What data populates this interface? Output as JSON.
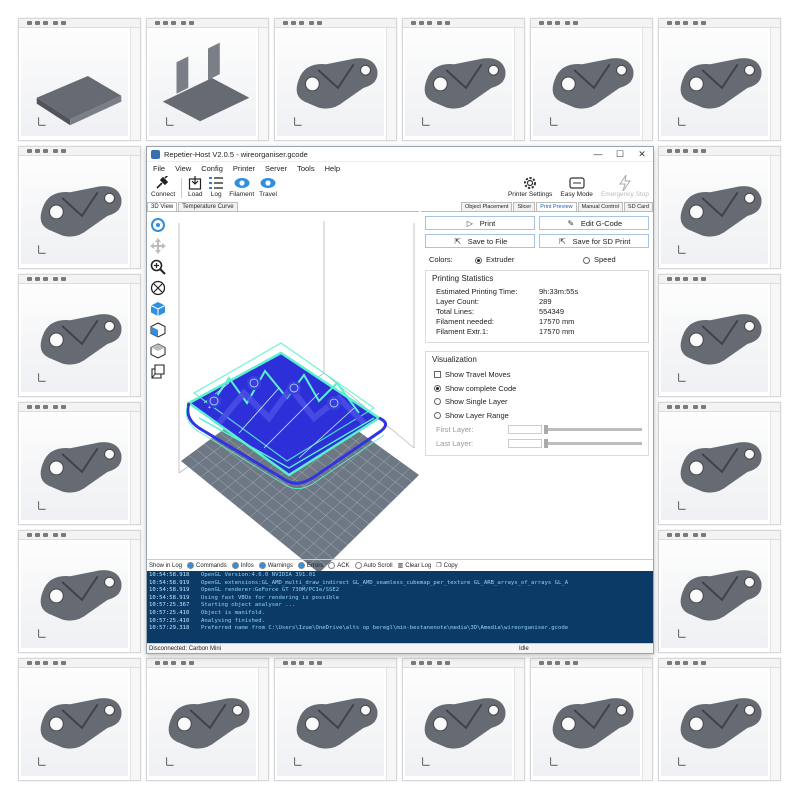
{
  "window": {
    "title": "Repetier-Host V2.0.5 - wireorganiser.gcode",
    "controls": [
      "—",
      "☐",
      "✕"
    ]
  },
  "menu": [
    "File",
    "View",
    "Config",
    "Printer",
    "Server",
    "Tools",
    "Help"
  ],
  "toolbar": {
    "left": [
      {
        "label": "Connect",
        "icon": "plug-icon"
      },
      {
        "label": "Load",
        "icon": "load-icon"
      },
      {
        "label": "Log",
        "icon": "log-icon"
      },
      {
        "label": "Filament",
        "icon": "eye-icon"
      },
      {
        "label": "Travel",
        "icon": "eye-icon"
      }
    ],
    "right": [
      {
        "label": "Printer Settings",
        "icon": "gear-icon"
      },
      {
        "label": "Easy Mode",
        "icon": "easy-mode-icon"
      },
      {
        "label": "Emergency Stop",
        "icon": "lightning-icon"
      }
    ]
  },
  "left_tabs": [
    "3D View",
    "Temperature Curve"
  ],
  "right_tabs": [
    "Object Placement",
    "Slicer",
    "Print Preview",
    "Manual Control",
    "SD Card"
  ],
  "right_active_tab": "Print Preview",
  "actions": {
    "print": "Print",
    "edit_gcode": "Edit G-Code",
    "save_file": "Save to File",
    "save_sd": "Save for SD Print"
  },
  "colors": {
    "label": "Colors:",
    "extruder": "Extruder",
    "speed": "Speed"
  },
  "stats": {
    "title": "Printing Statistics",
    "rows": [
      {
        "k": "Estimated Printing Time:",
        "v": "9h:33m:55s"
      },
      {
        "k": "Layer Count:",
        "v": "289"
      },
      {
        "k": "Total Lines:",
        "v": "554349"
      },
      {
        "k": "Filament needed:",
        "v": "17570 mm"
      },
      {
        "k": "Filament Extr.1:",
        "v": "17570 mm"
      }
    ]
  },
  "visualization": {
    "title": "Visualization",
    "show_travel": "Show Travel Moves",
    "show_complete": "Show complete Code",
    "show_single": "Show Single Layer",
    "show_range": "Show Layer Range",
    "first_layer": "First Layer:",
    "last_layer": "Last Layer:"
  },
  "logbar": {
    "show_in_log": "Show in Log",
    "commands": "Commands",
    "infos": "Infos",
    "warnings": "Warnings",
    "errors": "Errors",
    "ack": "ACK",
    "auto_scroll": "Auto Scroll",
    "clear_log": "Clear Log",
    "copy": "Copy"
  },
  "log": [
    {
      "t": "10:54:58.918",
      "m": "OpenGL Version:4.6.0 NVIDIA 391.01"
    },
    {
      "t": "10:54:58.919",
      "m": "OpenGL extensions:GL_AMD_multi_draw_indirect GL_AMD_seamless_cubemap_per_texture GL_ARB_arrays_of_arrays GL_A"
    },
    {
      "t": "10:54:58.919",
      "m": "OpenGL renderer:GeForce GT 730M/PCIe/SSE2"
    },
    {
      "t": "10:54:58.919",
      "m": "Using fast VBOs for rendering is possible"
    },
    {
      "t": "10:57:25.367",
      "m": "Starting object analyser ..."
    },
    {
      "t": "10:57:25.410",
      "m": "Object is manifold."
    },
    {
      "t": "10:57:25.410",
      "m": "Analysing finished."
    },
    {
      "t": "10:57:29.318",
      "m": "Preferred name from C:\\Users\\Izue\\OneDrive\\alts op beregl\\min-bestanenote\\media\\3D\\Amedia\\wireorganiser.gcode"
    }
  ],
  "status": {
    "connection": "Disconnected: Carbon Mini",
    "state": "Idle"
  },
  "palette": {
    "model": "#4a4de6",
    "infill": "#59f0cf",
    "grid": "#6f7a86",
    "part": "#666b73"
  }
}
